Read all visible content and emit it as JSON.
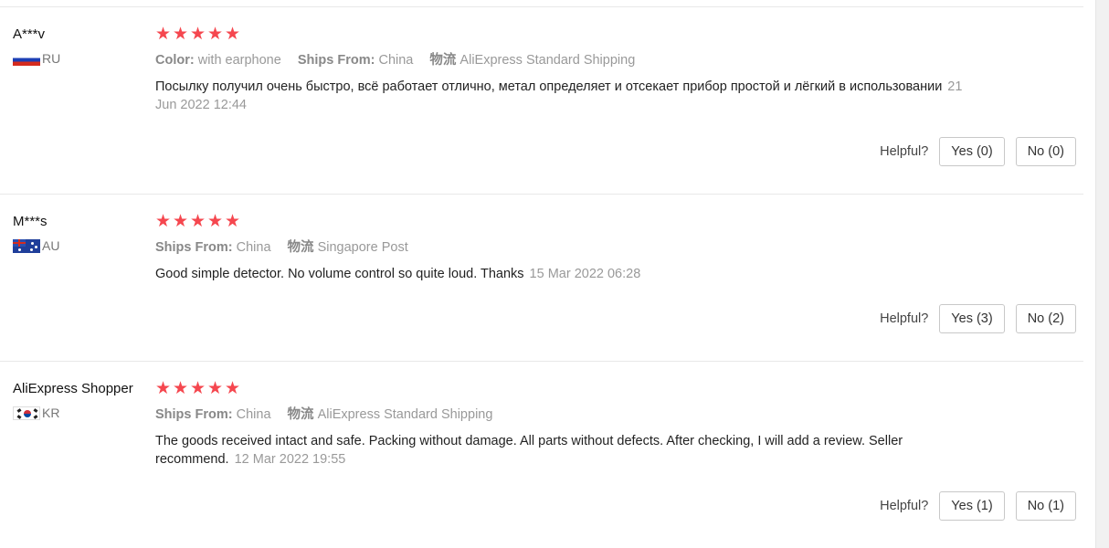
{
  "reviews": [
    {
      "user": "A***v",
      "country": "RU",
      "rating": 5,
      "sku": [
        {
          "label": "Color:",
          "value": "with earphone"
        },
        {
          "label": "Ships From:",
          "value": "China"
        },
        {
          "label": "物流",
          "value": "AliExpress Standard Shipping"
        }
      ],
      "text": "Посылку получил очень быстро, всё работает отлично, метал определяет и отсекает прибор простой и лёгкий в использовании",
      "date": "21 Jun 2022 12:44",
      "helpful_label": "Helpful?",
      "yes_label": "Yes (0)",
      "no_label": "No (0)"
    },
    {
      "user": "M***s",
      "country": "AU",
      "rating": 5,
      "sku": [
        {
          "label": "Ships From:",
          "value": "China"
        },
        {
          "label": "物流",
          "value": "Singapore Post"
        }
      ],
      "text": "Good simple detector. No volume control so quite loud. Thanks",
      "date": "15 Mar 2022 06:28",
      "helpful_label": "Helpful?",
      "yes_label": "Yes (3)",
      "no_label": "No (2)"
    },
    {
      "user": "AliExpress Shopper",
      "country": "KR",
      "rating": 5,
      "sku": [
        {
          "label": "Ships From:",
          "value": "China"
        },
        {
          "label": "物流",
          "value": "AliExpress Standard Shipping"
        }
      ],
      "text": "The goods received intact and safe. Packing without damage. All parts without defects. After checking, I will add a review. Seller recommend.",
      "date": "12 Mar 2022 19:55",
      "helpful_label": "Helpful?",
      "yes_label": "Yes (1)",
      "no_label": "No (1)"
    }
  ],
  "star_glyph": "★",
  "colors": {
    "star": "#f5474f",
    "muted": "#999999",
    "text": "#222222"
  }
}
